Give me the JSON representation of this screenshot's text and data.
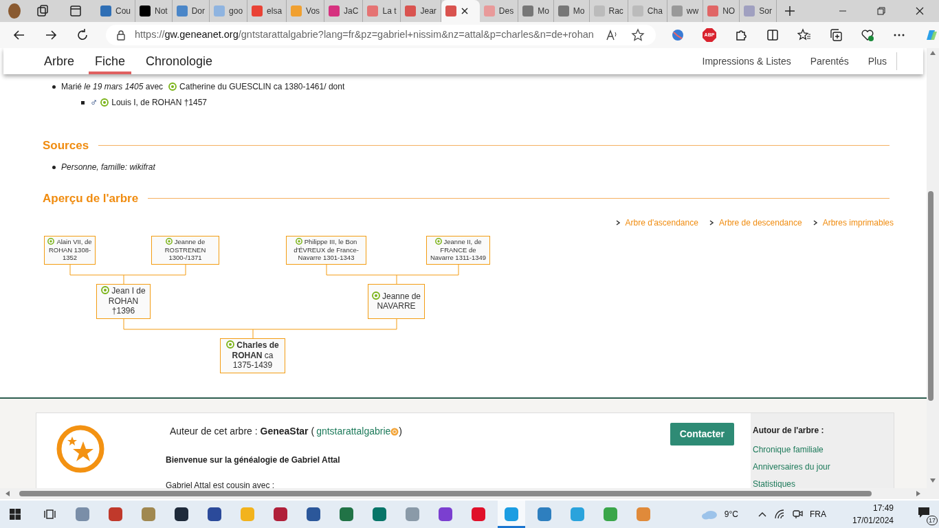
{
  "browser": {
    "tabs": [
      {
        "label": "Cou",
        "color": "#2f6fb5",
        "selected": false
      },
      {
        "label": "Not",
        "color": "#000000",
        "selected": false
      },
      {
        "label": "Dor",
        "color": "#4a86c8",
        "selected": false
      },
      {
        "label": "goo",
        "color": "#8fb4e0",
        "selected": false
      },
      {
        "label": "elsa",
        "color": "#e94235",
        "selected": false
      },
      {
        "label": "Vos",
        "color": "#f0a030",
        "selected": false
      },
      {
        "label": "JaC",
        "color": "#d6317f",
        "selected": false
      },
      {
        "label": "La t",
        "color": "#e57373",
        "selected": false
      },
      {
        "label": "Jear",
        "color": "#d9534f",
        "selected": false
      },
      {
        "color": "#d9534f",
        "selected": true
      },
      {
        "label": "Des",
        "color": "#e89a9a",
        "selected": false
      },
      {
        "label": "Mo",
        "color": "#777777",
        "selected": false
      },
      {
        "label": "Mo",
        "color": "#777777",
        "selected": false
      },
      {
        "label": "Rac",
        "color": "#bbbbbb",
        "selected": false
      },
      {
        "label": "Cha",
        "color": "#bbbbbb",
        "selected": false
      },
      {
        "label": "ww",
        "color": "#999999",
        "selected": false
      },
      {
        "label": "NO",
        "color": "#e06666",
        "selected": false
      },
      {
        "label": "Sor",
        "color": "#a0a0c0",
        "selected": false
      }
    ],
    "url": {
      "scheme": "https://",
      "host": "gw.geneanet.org",
      "path": "/gntstarattalgabrie?lang=fr&pz=gabriel+nissim&nz=attal&p=charles&n=de+rohan"
    },
    "adblock_label": "ABP"
  },
  "nav": {
    "tabs": [
      {
        "label": "Arbre",
        "selected": false
      },
      {
        "label": "Fiche",
        "selected": true
      },
      {
        "label": "Chronologie",
        "selected": false
      }
    ],
    "links": [
      "Impressions & Listes",
      "Parentés",
      "Plus"
    ]
  },
  "union": {
    "marriage": "Marié *le 19 mars 1405* avec",
    "spouse": "Catherine du GUESCLIN ca 1380-1461/ dont",
    "children": [
      {
        "sex": "♂",
        "name": "Louis I, de ROHAN †1457"
      }
    ]
  },
  "sources": {
    "heading": "Sources",
    "items": [
      "Personne, famille: wikifrat"
    ]
  },
  "tree_preview": {
    "heading": "Aperçu de l'arbre",
    "links": [
      "Arbre d'ascendance",
      "Arbre de descendance",
      "Arbres imprimables"
    ],
    "tree": {
      "name": "**Charles de ROHAN** ca 1375-1439",
      "children": [
        {
          "name": "Jean I de ROHAN †1396",
          "children": [
            {
              "name": "Alain VII, de ROHAN 1308-1352"
            },
            {
              "name": "Jeanne de ROSTRENEN 1300-/1371"
            }
          ]
        },
        {
          "name": "Jeanne de NAVARRE",
          "children": [
            {
              "name": "Philippe III, le Bon d'ÉVREUX de France-Navarre 1301-1343"
            },
            {
              "name": "Jeanne II, de FRANCE de Navarre 1311-1349"
            }
          ]
        }
      ]
    }
  },
  "author": {
    "label": "Auteur de cet arbre : **GeneaStar** (",
    "login": "gntstarattalgabrie",
    "close": ")",
    "contact": "Contacter",
    "welcome": "Bienvenue sur la généalogie de Gabriel Attal",
    "cousin": "Gabriel Attal est cousin avec :",
    "sidebar_title": "Autour de l'arbre :",
    "sidebar_links": [
      "Chronique familiale",
      "Anniversaires du jour",
      "Statistiques"
    ]
  },
  "taskbar": {
    "apps": [
      {
        "color": "#7a8ea8",
        "selected": false
      },
      {
        "color": "#c0392b",
        "selected": false
      },
      {
        "color": "#a08850",
        "selected": false
      },
      {
        "color": "#1e2a3a",
        "selected": false
      },
      {
        "color": "#2b4a9a",
        "selected": false
      },
      {
        "color": "#f2b31d",
        "selected": false
      },
      {
        "color": "#b0203a",
        "selected": false
      },
      {
        "color": "#2b579a",
        "selected": false
      },
      {
        "color": "#217346",
        "selected": false
      },
      {
        "color": "#077568",
        "selected": false
      },
      {
        "color": "#8a9aa8",
        "selected": false
      },
      {
        "color": "#7b3fd0",
        "selected": false
      },
      {
        "color": "#e0102a",
        "selected": false
      },
      {
        "color": "#1b9de2",
        "selected": true
      },
      {
        "color": "#2e7fbf",
        "selected": false
      },
      {
        "color": "#2aa3dc",
        "selected": false
      },
      {
        "color": "#3aa64a",
        "selected": false
      },
      {
        "color": "#e08a3a",
        "selected": false
      }
    ],
    "weather": "9°C",
    "language": "FRA",
    "time": "17:49",
    "date": "17/01/2024",
    "notifications": "17"
  }
}
